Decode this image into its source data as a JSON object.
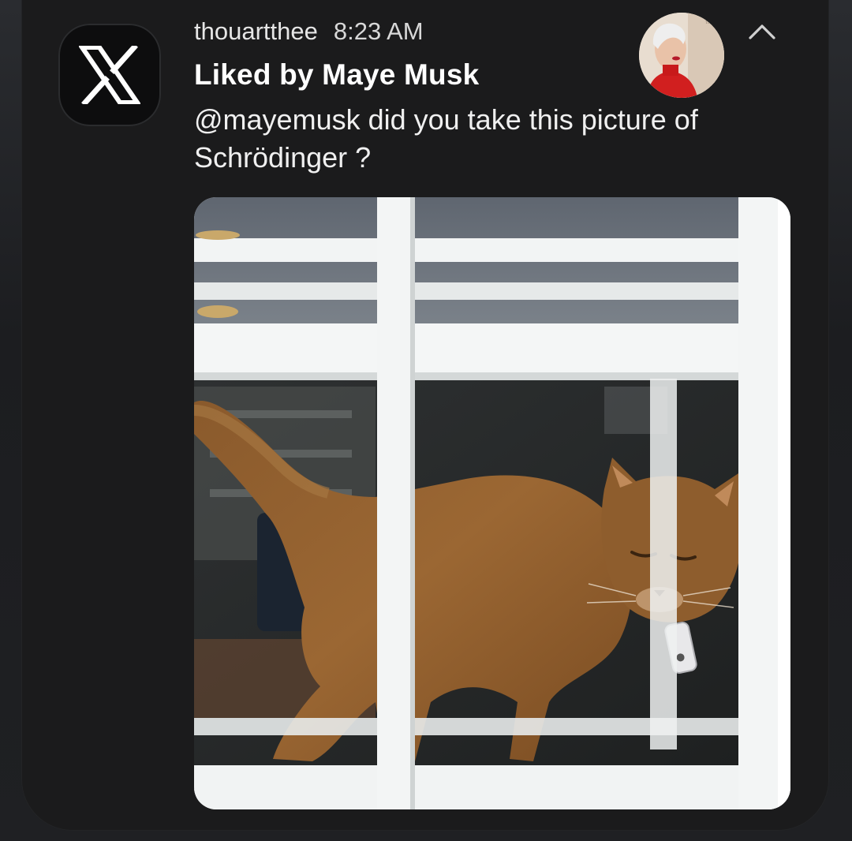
{
  "notification": {
    "app_name": "X",
    "username": "thouartthee",
    "time": "8:23 AM",
    "title": "Liked by Maye Musk",
    "body": "@mayemusk did you take this picture of Schrödinger ?",
    "expand_icon": "chevron-up-icon"
  },
  "media": {
    "type": "photo",
    "subject": "cat in window"
  },
  "colors": {
    "card_bg": "#1b1b1c",
    "title": "#ffffff",
    "text": "#f0f0f0",
    "app_icon_bg": "#0d0d0e"
  }
}
